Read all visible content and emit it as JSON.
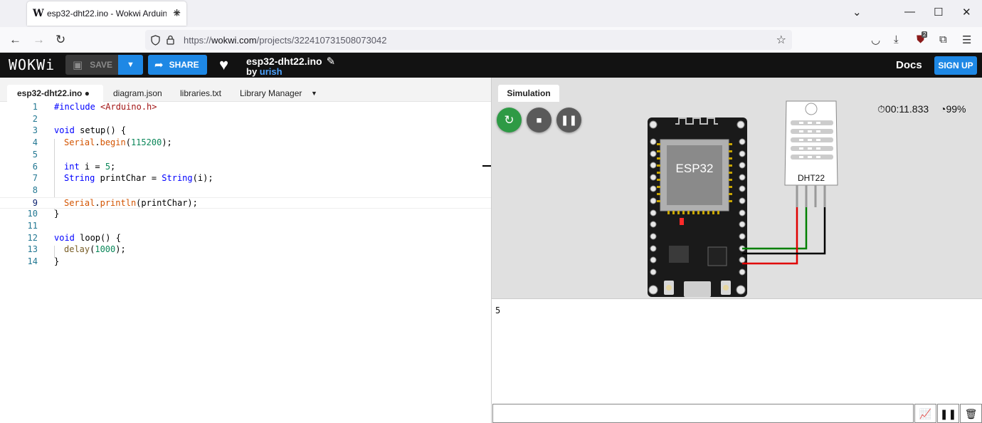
{
  "browser": {
    "tab_title": "esp32-dht22.ino - Wokwi Arduino",
    "favicon": "W",
    "url_prefix": "https://",
    "url_host": "wokwi.com",
    "url_path": "/projects/322410731508073042",
    "extensions_badge": "2"
  },
  "header": {
    "logo": "WOKWi",
    "save_label": "SAVE",
    "share_label": "SHARE",
    "project_name": "esp32-dht22.ino",
    "by_prefix": "by ",
    "author": "urish",
    "docs_label": "Docs",
    "signup_label": "SIGN UP"
  },
  "editor": {
    "tabs": [
      {
        "label": "esp32-dht22.ino ●"
      },
      {
        "label": "diagram.json"
      },
      {
        "label": "libraries.txt"
      },
      {
        "label": "Library Manager"
      }
    ],
    "lines": [
      {
        "n": "1"
      },
      {
        "n": "2"
      },
      {
        "n": "3"
      },
      {
        "n": "4"
      },
      {
        "n": "5"
      },
      {
        "n": "6"
      },
      {
        "n": "7"
      },
      {
        "n": "8"
      },
      {
        "n": "9"
      },
      {
        "n": "10"
      },
      {
        "n": "11"
      },
      {
        "n": "12"
      },
      {
        "n": "13"
      },
      {
        "n": "14"
      }
    ],
    "code": {
      "l1a": "#include ",
      "l1b": "<Arduino.h>",
      "l3a": "void",
      "l3b": " setup() {",
      "l4a": "Serial",
      "l4b": ".",
      "l4c": "begin",
      "l4d": "(",
      "l4e": "115200",
      "l4f": ");",
      "l6a": "int",
      "l6b": " i = ",
      "l6c": "5",
      "l6d": ";",
      "l7a": "String",
      "l7b": " printChar = ",
      "l7c": "String",
      "l7d": "(i);",
      "l9a": "Serial",
      "l9b": ".",
      "l9c": "println",
      "l9d": "(printChar);",
      "l10": "}",
      "l12a": "void",
      "l12b": " loop() {",
      "l13a": "delay",
      "l13b": "(",
      "l13c": "1000",
      "l13d": ");",
      "l14": "}"
    }
  },
  "simulation": {
    "tab_label": "Simulation",
    "timer": "00:11.833",
    "performance": "99%",
    "board_label": "ESP32",
    "sensor_label": "DHT22"
  },
  "serial": {
    "output": "5"
  },
  "colors": {
    "accent": "#1e88e5",
    "header_bg": "#121212",
    "restart_green": "#2e9a45",
    "control_gray": "#5a5a5a",
    "wire_green": "#008000",
    "wire_red": "#e00000",
    "wire_black": "#000000"
  }
}
